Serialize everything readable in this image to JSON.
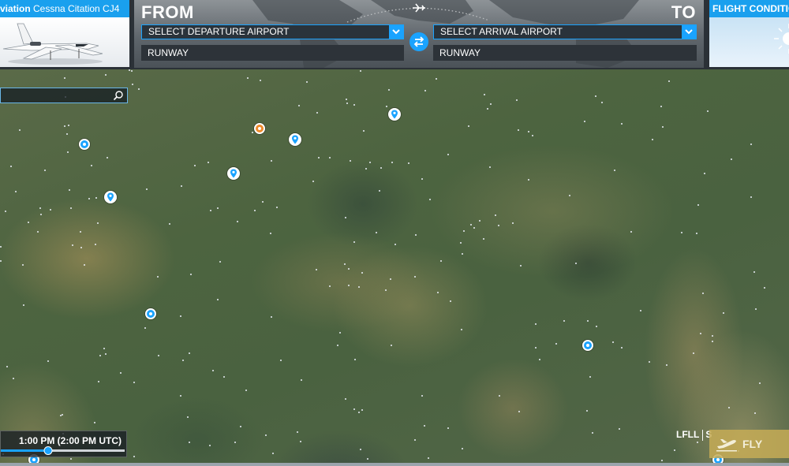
{
  "aircraft": {
    "title_prefix": "viation",
    "title_name": "Cessna Citation CJ4"
  },
  "route": {
    "from_label": "FROM",
    "to_label": "TO",
    "departure_placeholder": "SELECT DEPARTURE AIRPORT",
    "arrival_placeholder": "SELECT ARRIVAL AIRPORT",
    "departure_runway": "RUNWAY",
    "arrival_runway": "RUNWAY"
  },
  "conditions": {
    "title": "FLIGHT CONDITION"
  },
  "time": {
    "label": "1:00 PM (2:00 PM UTC)",
    "slider_fraction": 0.38
  },
  "airport_codes": {
    "code1": "LFLL",
    "code2": "S"
  },
  "fly": {
    "label": "FLY"
  },
  "icons": [
    "search-icon",
    "swap-icon",
    "chevron-down-icon",
    "airport-marker-icon",
    "poi-marker-icon",
    "plane-takeoff-icon"
  ],
  "colors": {
    "accent": "#1aa3ff",
    "orange_marker": "#ef8a2b",
    "fly_button": "#c6ac56"
  }
}
